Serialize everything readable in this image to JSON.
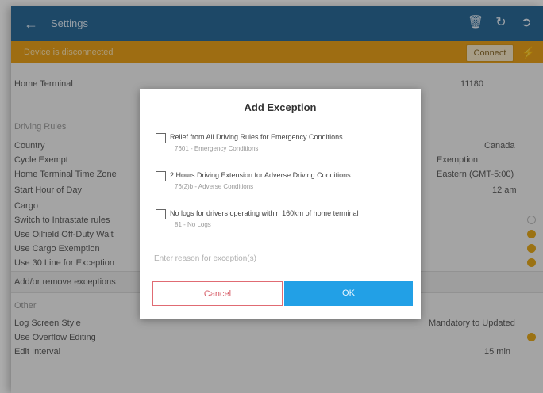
{
  "app": {
    "title": "Settings",
    "back_icon": "back-arrow-icon",
    "icons": [
      "trash-icon",
      "refresh-icon",
      "logout-icon"
    ]
  },
  "banner": {
    "text": "Device is disconnected",
    "connect_label": "Connect",
    "icon": "bolt-icon",
    "color": "#e9a11b"
  },
  "settings": {
    "home_terminal_label": "Home Terminal",
    "home_terminal_value": "11180",
    "section_driving_rules": "Driving Rules",
    "rows": [
      {
        "label": "Country",
        "value": "Canada"
      },
      {
        "label": "Cycle Exempt",
        "value": "Exemption"
      },
      {
        "label": "Home Terminal Time Zone",
        "value": "Eastern (GMT-5:00)"
      },
      {
        "label": "Start Hour of Day",
        "value": "12 am"
      },
      {
        "label": "Cargo",
        "value": ""
      },
      {
        "label": "Switch to Intrastate rules",
        "value": ""
      },
      {
        "label": "Use Oilfield Off-Duty Wait",
        "value": ""
      },
      {
        "label": "Use Cargo Exemption",
        "value": ""
      },
      {
        "label": "Use 30 Line for Exception",
        "value": ""
      },
      {
        "label": "Add/or remove exceptions",
        "value": ""
      }
    ],
    "section_other": "Other",
    "other_rows": [
      {
        "label": "Log Screen Style",
        "value": "Mandatory to Updated"
      },
      {
        "label": "Use Overflow Editing",
        "value": ""
      },
      {
        "label": "Edit Interval",
        "value": "15 min"
      }
    ],
    "toggle_color": "#e5a81c"
  },
  "dialog": {
    "title": "Add Exception",
    "options": [
      {
        "label": "Relief from All Driving Rules for Emergency Conditions",
        "sub": "7601 - Emergency Conditions",
        "checked": false
      },
      {
        "label": "2 Hours Driving Extension for Adverse Driving Conditions",
        "sub": "76(2)b - Adverse Conditions",
        "checked": false
      },
      {
        "label": "No logs for drivers operating within 160km of home terminal",
        "sub": "81 - No Logs",
        "checked": false
      }
    ],
    "reason_placeholder": "Enter reason for exception(s)",
    "reason_value": "",
    "cancel_label": "Cancel",
    "ok_label": "OK",
    "ok_color": "#22a0e6",
    "cancel_color": "#d65b65"
  }
}
